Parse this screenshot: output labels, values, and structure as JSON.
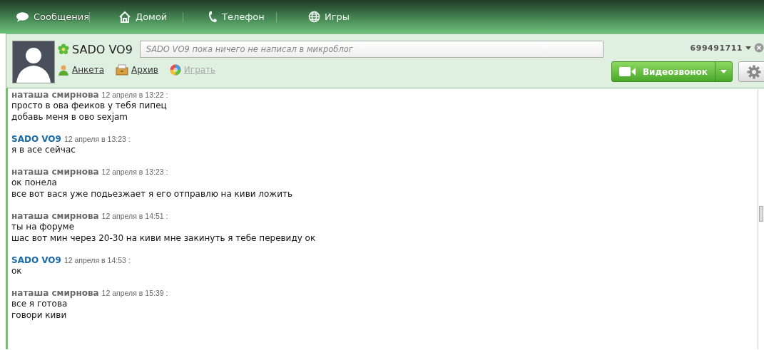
{
  "tabs": [
    {
      "label": "Сообщения",
      "selected": true
    },
    {
      "label": "Домой",
      "selected": false
    },
    {
      "label": "Телефон",
      "selected": false
    },
    {
      "label": "Игры",
      "selected": false
    }
  ],
  "contact": {
    "name": "SADO VO9",
    "status_placeholder": "SADO VO9 пока ничего не написал в микроблог",
    "number": "699491711",
    "links": [
      {
        "label": "Анкета",
        "disabled": false
      },
      {
        "label": "Архив",
        "disabled": false
      },
      {
        "label": "Играть",
        "disabled": true
      }
    ],
    "video_button": "Видеозвонок"
  },
  "messages": [
    {
      "author": "наташа смирнова",
      "kind": "contact",
      "time": "12 апреля в 13:22 :",
      "lines": [
        "просто в ова феиков у тебя пипец",
        "добавь меня в ово sexjam"
      ]
    },
    {
      "author": "SADO VO9",
      "kind": "self",
      "time": "12 апреля в 13:23 :",
      "lines": [
        "я в асе сейчас"
      ]
    },
    {
      "author": "наташа смирнова",
      "kind": "contact",
      "time": "12 апреля в 13:23 :",
      "lines": [
        "ок понела",
        "все вот вася уже подьезжает я его отправлю на киви ложить"
      ]
    },
    {
      "author": "наташа смирнова",
      "kind": "contact",
      "time": "12 апреля в 14:51 :",
      "lines": [
        "ты на форуме",
        "шас вот мин через 20-30 на киви мне закинуть я тебе перевиду ок"
      ]
    },
    {
      "author": "SADO VO9",
      "kind": "self",
      "time": "12 апреля в 14:53 :",
      "lines": [
        "ок"
      ]
    },
    {
      "author": "наташа смирнова",
      "kind": "contact",
      "time": "12 апреля в 15:39 :",
      "lines": [
        "все я готова",
        "говори киви"
      ]
    }
  ]
}
